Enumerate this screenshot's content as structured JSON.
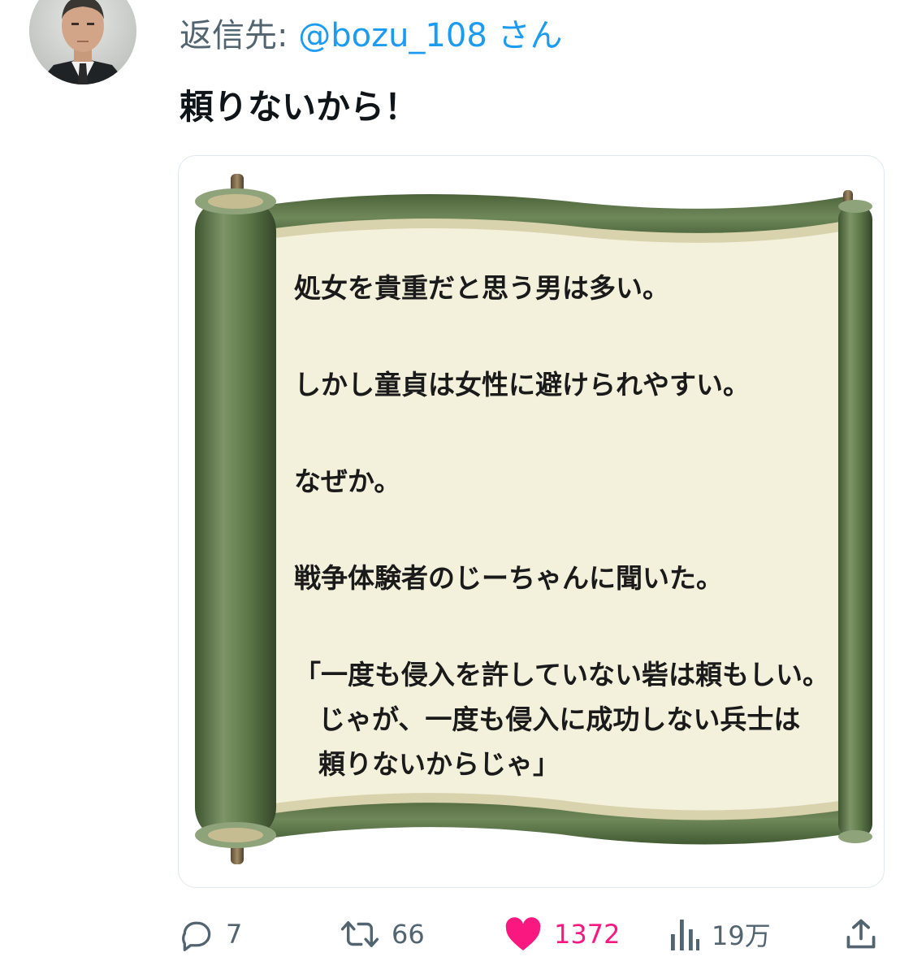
{
  "reply_header": {
    "prefix": "返信先: ",
    "handle": "@bozu_108",
    "suffix": " さん"
  },
  "tweet": {
    "text": "頼りないから！"
  },
  "media": {
    "lines": [
      "処女を貴重だと思う男は多い。",
      "しかし童貞は女性に避けられやすい。",
      "なぜか。",
      "戦争体験者のじーちゃんに聞いた。",
      "「一度も侵入を許していない砦は頼もしい。",
      "じゃが、一度も侵入に成功しない兵士は",
      "頼りないからじゃ」"
    ],
    "colors": {
      "scroll_green": "#5b7447",
      "paper": "#f3f0dc"
    }
  },
  "actions": {
    "reply": {
      "icon": "reply-icon",
      "count": "7"
    },
    "retweet": {
      "icon": "retweet-icon",
      "count": "66"
    },
    "like": {
      "icon": "heart-icon",
      "count": "1372",
      "active": true,
      "color": "#f91880"
    },
    "views": {
      "icon": "views-icon",
      "count": "19万"
    },
    "share": {
      "icon": "share-icon"
    }
  }
}
